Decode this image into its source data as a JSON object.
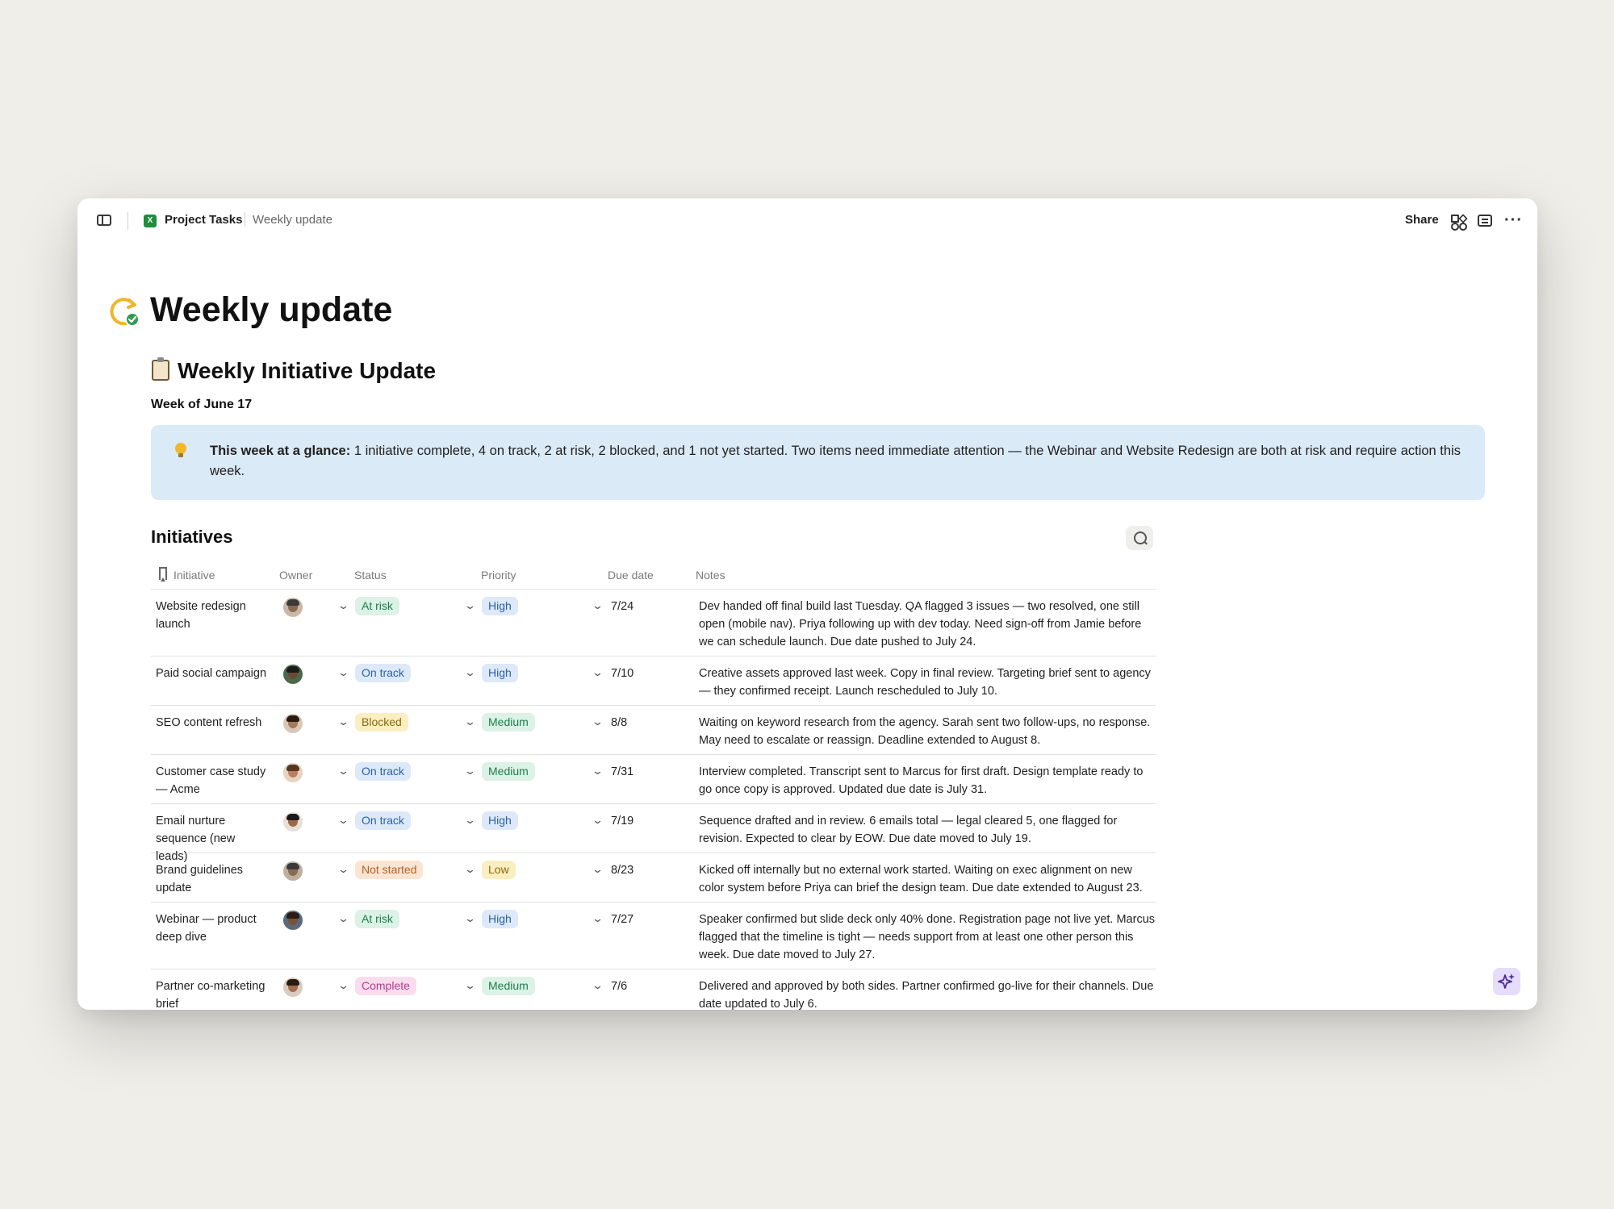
{
  "topbar": {
    "breadcrumb_parent": "Project Tasks",
    "breadcrumb_current": "Weekly update",
    "share_label": "Share",
    "app_icon_glyph": "X"
  },
  "page": {
    "title": "Weekly update",
    "section_title": "Weekly Initiative Update",
    "week_label": "Week of June 17"
  },
  "callout": {
    "lead": "This week at a glance:",
    "body": " 1 initiative complete, 4 on track, 2 at risk, 2 blocked, and 1 not yet started. Two items need immediate attention — the Webinar and Website Redesign are both at risk and require action this week."
  },
  "initiatives": {
    "title": "Initiatives",
    "columns": [
      "Initiative",
      "Owner",
      "Status",
      "Priority",
      "Due date",
      "Notes"
    ],
    "rows": [
      {
        "initiative": "Website redesign launch",
        "status": "At risk",
        "priority": "High",
        "due": "7/24",
        "notes": "Dev handed off final build last Tuesday. QA flagged 3 issues — two resolved, one still open (mobile nav). Priya following up with dev today. Need sign-off from Jamie before we can schedule launch. Due date pushed to July 24."
      },
      {
        "initiative": "Paid social campaign",
        "status": "On track",
        "priority": "High",
        "due": "7/10",
        "notes": "Creative assets approved last week. Copy in final review. Targeting brief sent to agency — they confirmed receipt. Launch rescheduled to July 10."
      },
      {
        "initiative": "SEO content refresh",
        "status": "Blocked",
        "priority": "Medium",
        "due": "8/8",
        "notes": "Waiting on keyword research from the agency. Sarah sent two follow-ups, no response. May need to escalate or reassign. Deadline extended to August 8."
      },
      {
        "initiative": "Customer case study — Acme",
        "status": "On track",
        "priority": "Medium",
        "due": "7/31",
        "notes": "Interview completed. Transcript sent to Marcus for first draft. Design template ready to go once copy is approved. Updated due date is July 31."
      },
      {
        "initiative": "Email nurture sequence (new leads)",
        "status": "On track",
        "priority": "High",
        "due": "7/19",
        "notes": "Sequence drafted and in review. 6 emails total — legal cleared 5, one flagged for revision. Expected to clear by EOW. Due date moved to July 19."
      },
      {
        "initiative": "Brand guidelines update",
        "status": "Not started",
        "priority": "Low",
        "due": "8/23",
        "notes": "Kicked off internally but no external work started. Waiting on exec alignment on new color system before Priya can brief the design team. Due date extended to August 23."
      },
      {
        "initiative": "Webinar — product deep dive",
        "status": "At risk",
        "priority": "High",
        "due": "7/27",
        "notes": "Speaker confirmed but slide deck only 40% done. Registration page not live yet. Marcus flagged that the timeline is tight — needs support from at least one other person this week. Due date moved to July 27."
      },
      {
        "initiative": "Partner co-marketing brief",
        "status": "Complete",
        "priority": "Medium",
        "due": "7/6",
        "notes": "Delivered and approved by both sides. Partner confirmed go-live for their channels. Due date updated to July 6."
      }
    ]
  },
  "colors": {
    "status": {
      "At risk": {
        "bg": "#dcf2e6",
        "fg": "#1e7d4b"
      },
      "On track": {
        "bg": "#dde9f8",
        "fg": "#2a62a8"
      },
      "Blocked": {
        "bg": "#fbeec0",
        "fg": "#8a6a10"
      },
      "Not started": {
        "bg": "#fbe5d2",
        "fg": "#b2602a"
      },
      "Complete": {
        "bg": "#f9ddee",
        "fg": "#b23b8a"
      }
    },
    "priority": {
      "High": {
        "bg": "#dde9f8",
        "fg": "#2a62a8"
      },
      "Medium": {
        "bg": "#dcf2e6",
        "fg": "#1e7d4b"
      },
      "Low": {
        "bg": "#fbeec0",
        "fg": "#8a6a10"
      }
    },
    "callout_bg": "#dbeaf7",
    "page_bg": "#efeee9"
  },
  "icons": [
    "sidebar-toggle-icon",
    "spreadsheet-app-icon",
    "apps-icon",
    "comment-icon",
    "more-icon",
    "sync-check-icon",
    "clipboard-icon",
    "lightbulb-icon",
    "search-icon",
    "bookmark-icon",
    "chevron-down-icon",
    "ai-sparkle-icon"
  ]
}
